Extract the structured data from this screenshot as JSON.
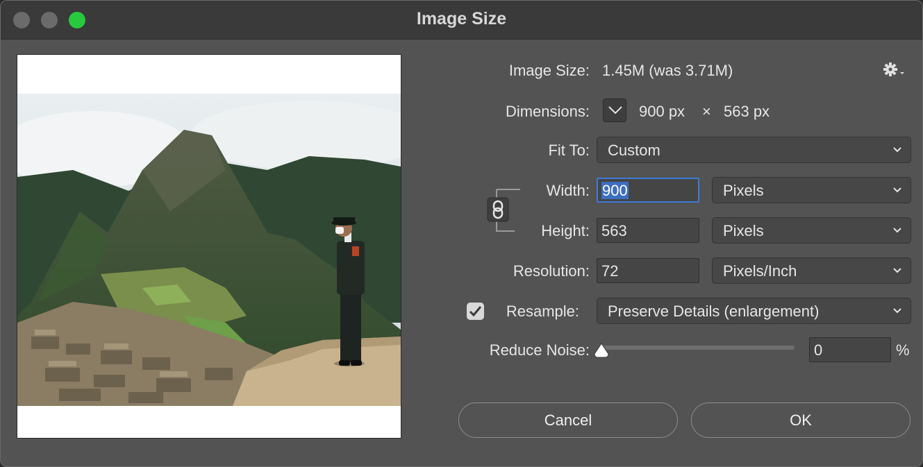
{
  "window": {
    "title": "Image Size"
  },
  "info": {
    "image_size_label": "Image Size:",
    "image_size_value": "1.45M (was 3.71M)",
    "dimensions_label": "Dimensions:",
    "width_value": "900 px",
    "times": "×",
    "height_value": "563 px"
  },
  "fit_to": {
    "label": "Fit To:",
    "value": "Custom"
  },
  "width": {
    "label": "Width:",
    "value": "900",
    "unit": "Pixels"
  },
  "height": {
    "label": "Height:",
    "value": "563",
    "unit": "Pixels"
  },
  "resolution": {
    "label": "Resolution:",
    "value": "72",
    "unit": "Pixels/Inch"
  },
  "resample": {
    "label": "Resample:",
    "checked": true,
    "value": "Preserve Details (enlargement)"
  },
  "reduce_noise": {
    "label": "Reduce Noise:",
    "value": "0",
    "unit": "%"
  },
  "buttons": {
    "cancel": "Cancel",
    "ok": "OK"
  },
  "icons": {
    "gear": "gear-icon",
    "link": "chain-link-icon",
    "dimensions_dropdown": "chevron-down-icon",
    "checkmark": "checkmark-icon"
  },
  "colors": {
    "accent": "#3f7bd6",
    "traffic_green": "#27c93f"
  }
}
